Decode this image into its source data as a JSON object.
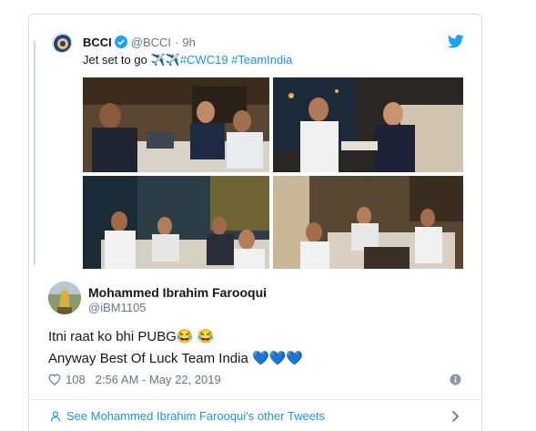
{
  "quoted_tweet": {
    "name": "BCCI",
    "handle": "@BCCI",
    "separator": "·",
    "time": "9h",
    "text_plain": "Jet set to go ",
    "text_emoji": "✈️✈️",
    "hashtags": "#CWC19 #TeamIndia",
    "photos": [
      "team in airport lounge",
      "players seated in lounge",
      "players at lounge tables",
      "players in lounge seating"
    ]
  },
  "tweet": {
    "author_name": "Mohammed Ibrahim Farooqui",
    "author_handle": "@iBM1105",
    "line1_text": "Itni raat ko bhi PUBG",
    "line1_emoji": "😂 😂",
    "line2_text": "Anyway Best Of Luck Team India ",
    "line2_emoji": "💙💙💙",
    "likes": "108",
    "timestamp": "2:56 AM - May 22, 2019"
  },
  "footer": {
    "see_more": "See Mohammed Ibrahim Farooqui's other Tweets"
  },
  "colors": {
    "link_blue": "#1b95e0",
    "heart_blue": "#5dadec",
    "muted": "#657786",
    "border": "#d9dee3"
  }
}
